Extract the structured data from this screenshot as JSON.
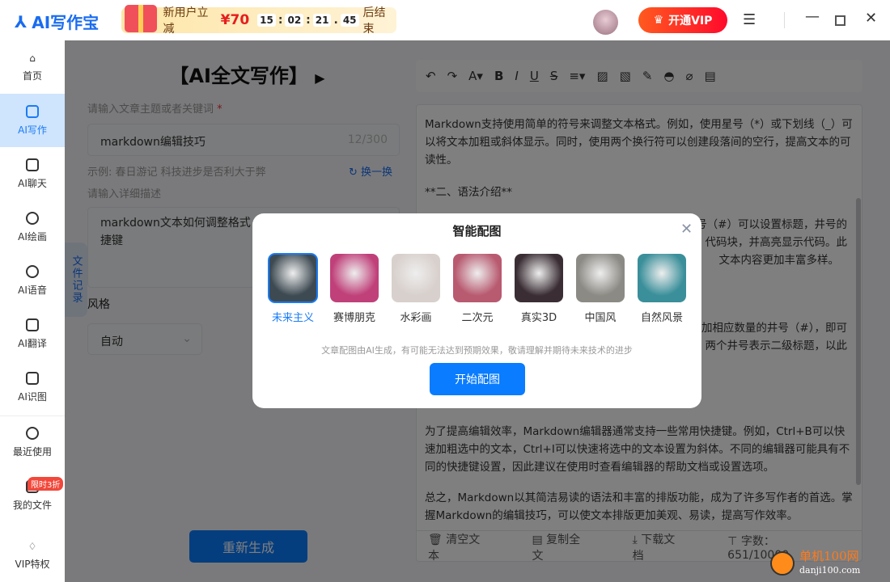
{
  "app": {
    "name": "AI写作宝"
  },
  "promo": {
    "text": "新用户立减",
    "price": "¥70",
    "countdown": [
      "15",
      "02",
      "21",
      "45"
    ],
    "suffix": "后结束"
  },
  "header": {
    "vip_label": "开通VIP",
    "menu_icon": "hamburger-icon",
    "window": [
      "minimize",
      "maximize",
      "close"
    ]
  },
  "sidebar": {
    "items": [
      {
        "label": "首页",
        "icon": "home-icon"
      },
      {
        "label": "AI写作",
        "icon": "edit-icon",
        "active": true
      },
      {
        "label": "AI聊天",
        "icon": "chat-icon"
      },
      {
        "label": "AI绘画",
        "icon": "palette-icon"
      },
      {
        "label": "AI语音",
        "icon": "voice-icon"
      },
      {
        "label": "AI翻译",
        "icon": "translate-icon"
      },
      {
        "label": "AI识图",
        "icon": "image-recognize-icon"
      },
      {
        "label": "最近使用",
        "icon": "history-icon"
      },
      {
        "label": "我的文件",
        "icon": "file-icon"
      },
      {
        "label": "VIP特权",
        "icon": "vip-icon"
      }
    ],
    "vip_badge": "限时3折"
  },
  "form": {
    "title": "【AI全文写作】",
    "topic_label": "请输入文章主题或者关键词",
    "required_mark": "*",
    "topic_value": "markdown编辑技巧",
    "topic_count": "12/300",
    "example": "示例: 春日游记 科技进步是否利大于弊",
    "refresh_label": "换一换",
    "desc_label": "请输入详细描述",
    "desc_value": "markdown文本如何调整格式，",
    "desc_value2": "捷键",
    "style_label": "风格",
    "style_value": "自动",
    "regenerate_label": "重新生成",
    "file_tab": "文件记录"
  },
  "editor": {
    "para1": "Markdown支持使用简单的符号来调整文本格式。例如，使用星号（*）或下划线（_）可以将文本加粗或斜体显示。同时，使用两个换行符可以创建段落间的空行，提高文本的可读性。",
    "heading2": "**二、语法介绍**",
    "frag1": "号（#）可以设置标题，井号的",
    "frag2": "代码块，并高亮显示代码。此",
    "frag3": "文本内容更加丰富多样。",
    "frag4": "加相应数量的井号（#），即可",
    "frag5": "两个井号表示二级标题，以此",
    "para3": "为了提高编辑效率，Markdown编辑器通常支持一些常用快捷键。例如，Ctrl+B可以快速加粗选中的文本，Ctrl+I可以快速将选中的文本设置为斜体。不同的编辑器可能具有不同的快捷键设置，因此建议在使用时查看编辑器的帮助文档或设置选项。",
    "para4": "总之，Markdown以其简洁易读的语法和丰富的排版功能，成为了许多写作者的首选。掌握Markdown的编辑技巧，可以使文本排版更加美观、易读，提高写作效率。",
    "clear_label": "清空文本",
    "copy_label": "复制全文",
    "download_label": "下载文档",
    "word_count": "字数：651/10000"
  },
  "modal": {
    "title": "智能配图",
    "styles": [
      {
        "label": "未来主义",
        "selected": true,
        "color": "#3d4a52"
      },
      {
        "label": "赛博朋克",
        "color": "#c0407a"
      },
      {
        "label": "水彩画",
        "color": "#d8d0cc"
      },
      {
        "label": "二次元",
        "color": "#b85a70"
      },
      {
        "label": "真实3D",
        "color": "#3a2e34"
      },
      {
        "label": "中国风",
        "color": "#8c8a84"
      },
      {
        "label": "自然风景",
        "color": "#3a8f9a"
      }
    ],
    "note": "文章配图由AI生成，有可能无法达到预期效果，敬请理解并期待未来技术的进步",
    "start_label": "开始配图"
  },
  "watermark": {
    "text": "单机100网",
    "url": "danji100.com"
  }
}
